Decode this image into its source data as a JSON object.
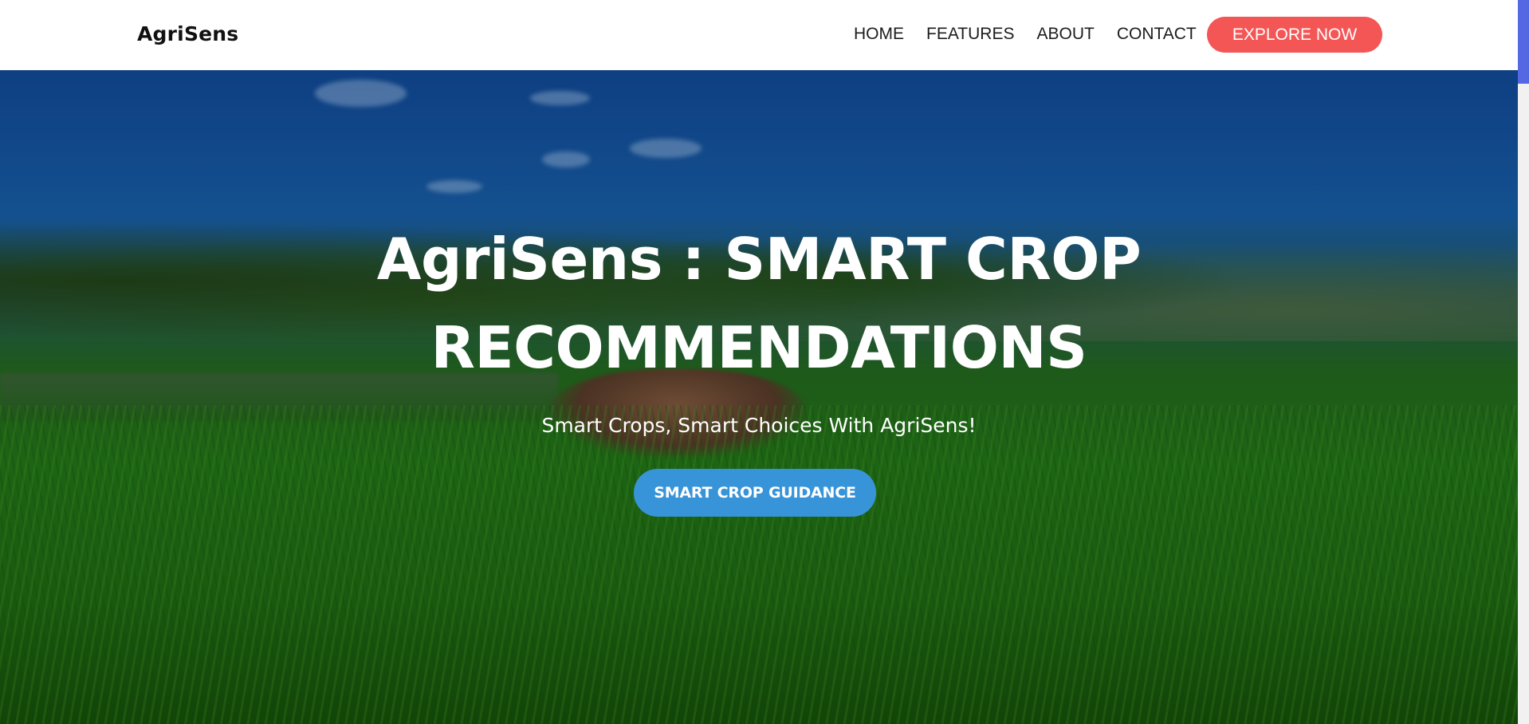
{
  "brand": {
    "name": "AgriSens"
  },
  "nav": {
    "items": [
      {
        "label": "HOME"
      },
      {
        "label": "FEATURES"
      },
      {
        "label": "ABOUT"
      },
      {
        "label": "CONTACT"
      }
    ],
    "cta_label": "EXPLORE NOW"
  },
  "hero": {
    "title_line1": "AgriSens : SMART CROP",
    "title_line2": "RECOMMENDATIONS",
    "tagline": "Smart Crops, Smart Choices With AgriSens!",
    "cta_label": "SMART CROP GUIDANCE"
  },
  "colors": {
    "explore_button": "#f45656",
    "guidance_button": "#3894d8",
    "scrollbar_thumb": "#5468e4"
  }
}
